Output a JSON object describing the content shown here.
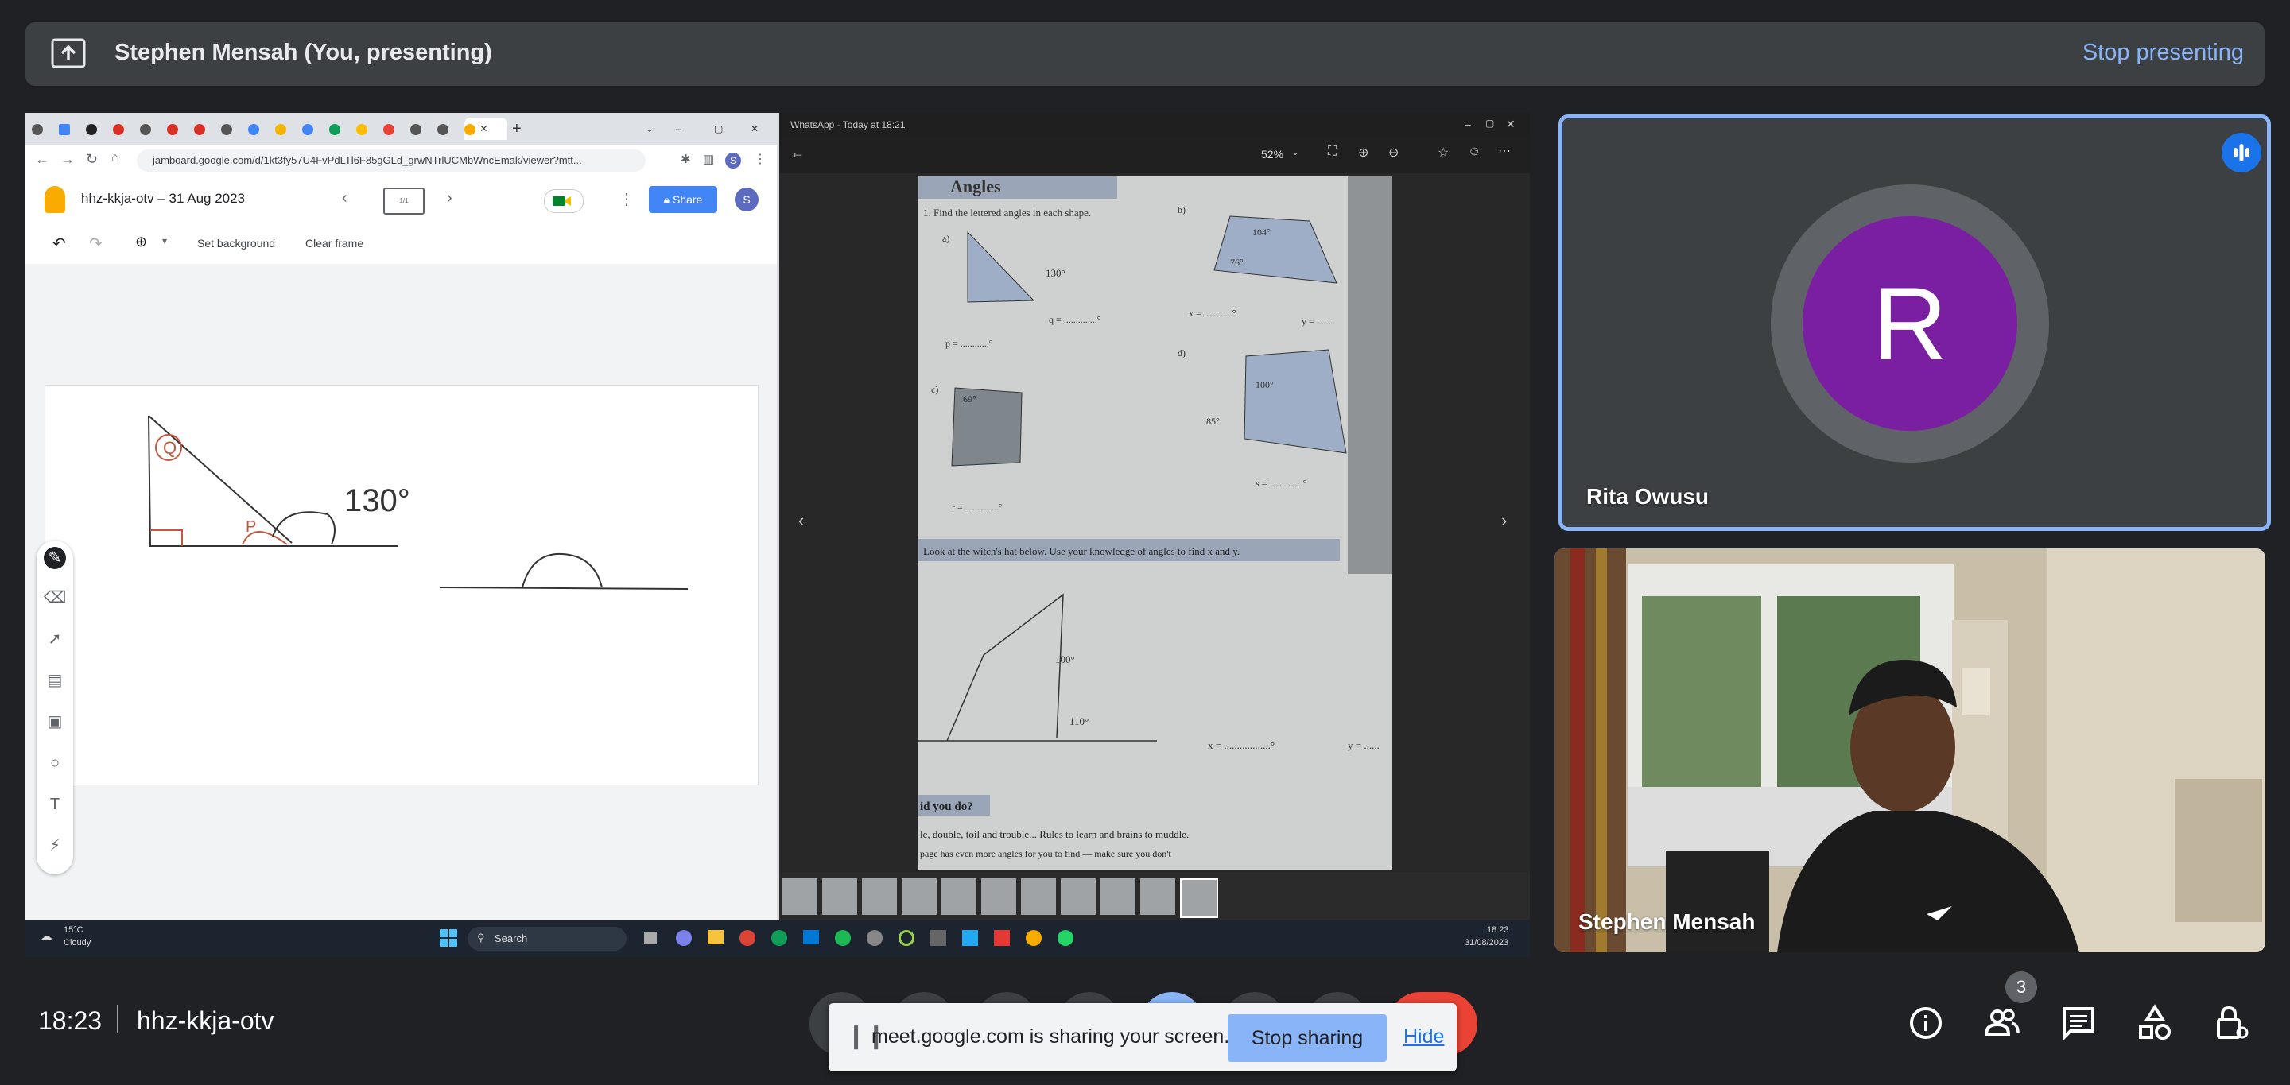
{
  "banner": {
    "title": "Stephen Mensah (You, presenting)",
    "stop_label": "Stop presenting"
  },
  "chrome": {
    "url": "jamboard.google.com/d/1kt3fy57U4FvPdLTl6F85gGLd_grwNTrlUCMbWncEmak/viewer?mtt...",
    "profile_initial": "S"
  },
  "jamboard": {
    "title": "hhz-kkja-otv – 31 Aug 2023",
    "share_label": "Share",
    "avatar_initial": "S",
    "frame_indicator": "1/1",
    "set_background_label": "Set background",
    "clear_frame_label": "Clear frame",
    "drawing_labels": {
      "q": "Q",
      "p": "P",
      "angle": "130°"
    }
  },
  "whatsapp": {
    "title": "WhatsApp - Today at 18:21",
    "zoom": "52%",
    "photo_text": {
      "heading": "Angles",
      "q1": "1.  Find the lettered angles in each shape.",
      "a_label": "a)",
      "b_label": "b)",
      "c_label": "c)",
      "d_label": "d)",
      "a_angle": "130°",
      "b_angle1": "104°",
      "b_angle2": "76°",
      "c_angle": "69°",
      "d_angle1": "100°",
      "d_angle2": "85°",
      "p_eq": "p = ............°",
      "q_eq": "q = ..............°",
      "x_eq": "x = ............°",
      "y_eq": "y = ......",
      "r_eq": "r = ..............°",
      "s_eq": "s = ..............°",
      "witch": "Look at the witch's hat below.  Use your knowledge of angles to find x and y.",
      "hat_angle1": "100°",
      "hat_angle2": "110°",
      "hat_x_eq": "x = ..................°",
      "hat_y_eq": "y = ......",
      "did_you_do": "id you do?",
      "footer1": "le, double, toil and trouble...  Rules to learn and brains to muddle.",
      "footer2": "page has even more angles for you to find — make sure you don't"
    }
  },
  "taskbar": {
    "weather_temp": "15°C",
    "weather_desc": "Cloudy",
    "search_label": "Search",
    "clock_time": "18:23",
    "clock_date": "31/08/2023"
  },
  "participants": {
    "rita": {
      "name": "Rita Owusu",
      "initial": "R",
      "avatar_color": "#7b1fa2"
    },
    "stephen": {
      "name": "Stephen Mensah"
    }
  },
  "bottom": {
    "time": "18:23",
    "meeting_code": "hhz-kkja-otv",
    "participant_count": "3"
  },
  "share_notice": {
    "message": "meet.google.com is sharing your screen.",
    "stop_label": "Stop sharing",
    "hide_label": "Hide"
  },
  "colors": {
    "accent": "#8ab4f8",
    "end_call": "#ea4335",
    "bg": "#202124"
  }
}
